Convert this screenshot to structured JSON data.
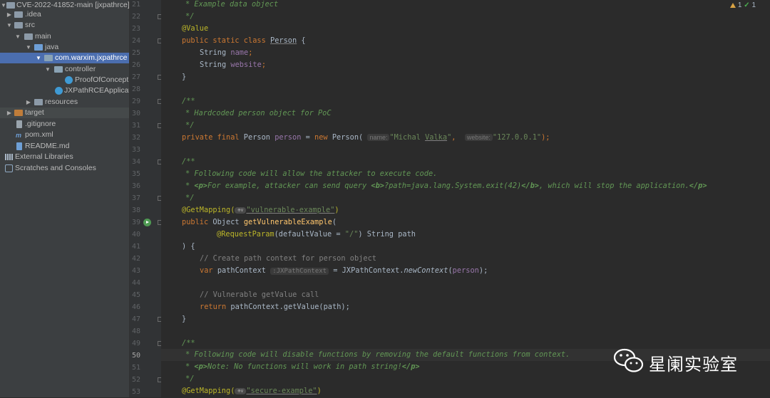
{
  "project_tree": {
    "root": "CVE-2022-41852-main [jxpathrce]",
    "idea": ".idea",
    "src": "src",
    "main": "main",
    "java": "java",
    "package": "com.warxim.jxpathrce",
    "controller": "controller",
    "poc_class": "ProofOfConcept",
    "app_class": "JXPathRCEApplicati",
    "resources": "resources",
    "target": "target",
    "gitignore": ".gitignore",
    "pom": "pom.xml",
    "readme": "README.md",
    "external_libraries": "External Libraries",
    "scratches": "Scratches and Consoles"
  },
  "inspections": {
    "warnings": "1",
    "ok": "1"
  },
  "gutter": {
    "lines": [
      "21",
      "22",
      "23",
      "24",
      "25",
      "26",
      "27",
      "28",
      "29",
      "30",
      "31",
      "32",
      "33",
      "34",
      "35",
      "36",
      "37",
      "38",
      "39",
      "40",
      "41",
      "42",
      "43",
      "44",
      "45",
      "46",
      "47",
      "48",
      "49",
      "50",
      "51",
      "52",
      "53"
    ]
  },
  "code": {
    "l21": "* Example data object",
    "l22": "*/",
    "l23": "@Value",
    "l24_kw": "public static class ",
    "l24_name": "Person",
    "l24_end": " {",
    "l25_type": "String ",
    "l25_field": "name",
    "l25_end": ";",
    "l26_type": "String ",
    "l26_field": "website",
    "l26_end": ";",
    "l27": "}",
    "l29": "/**",
    "l30": "* Hardcoded person object for PoC",
    "l31": "*/",
    "l32_kw": "private final ",
    "l32_type": "Person ",
    "l32_field": "person",
    "l32_eq": " = ",
    "l32_new": "new ",
    "l32_ctor": "Person( ",
    "l32_hint1": "name:",
    "l32_str1a": "\"Michal ",
    "l32_str1b": "Valka",
    "l32_str1c": "\"",
    "l32_comma": ",  ",
    "l32_hint2": "website:",
    "l32_str2": "\"127.0.0.1\"",
    "l32_end": ");",
    "l34": "/**",
    "l35": "* Following code will allow the attacker to execute code.",
    "l36_a": "* ",
    "l36_p": "<p>",
    "l36_b": "For example, attacker can send query ",
    "l36_bo": "<b>",
    "l36_c": "?path=java.lang.System.exit(42)",
    "l36_bc": "</b>",
    "l36_d": ", which will stop the application.",
    "l36_pc": "</p>",
    "l37": "*/",
    "l38_ann": "@GetMapping(",
    "l38_globe": "⊕∨",
    "l38_str": "\"vulnerable-example\"",
    "l38_end": ")",
    "l39_kw": "public ",
    "l39_type": "Object ",
    "l39_fn": "getVulnerableExample",
    "l39_end": "(",
    "l40_ann": "@RequestParam",
    "l40_a": "(defaultValue = ",
    "l40_str": "\"/\"",
    "l40_b": ") String path",
    "l41": ") {",
    "l42": "// Create path context for person object",
    "l43_kw": "var ",
    "l43_a": "pathContext ",
    "l43_hint": ":JXPathContext",
    "l43_b": " = JXPathContext.",
    "l43_fn": "newContext",
    "l43_c": "(",
    "l43_field": "person",
    "l43_d": ");",
    "l45": "// Vulnerable getValue call",
    "l46_kw": "return ",
    "l46_a": "pathContext.getValue(path);",
    "l47": "}",
    "l49": "/**",
    "l50": "* Following code will disable functions by removing the default functions from context.",
    "l51_a": "* ",
    "l51_p": "<p>",
    "l51_b": "Note: No functions will work in path string!",
    "l51_pc": "</p>",
    "l52": "*/",
    "l53_ann": "@GetMapping(",
    "l53_globe": "⊕∨",
    "l53_str": "\"secure-example\"",
    "l53_end": ")"
  },
  "watermark": {
    "text": "星阑实验室"
  }
}
